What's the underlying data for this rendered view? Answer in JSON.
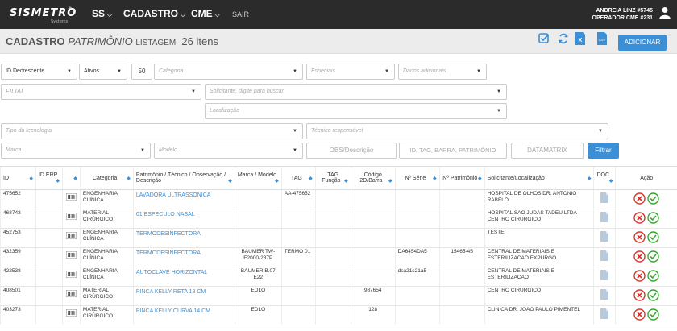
{
  "topbar": {
    "logo": "SISMETRO",
    "logo_sub": "Systems",
    "logo_reg": "®",
    "nav": [
      {
        "label": "SS",
        "caret": "⌵"
      },
      {
        "label": "CADASTRO",
        "caret": "⌵"
      },
      {
        "label": "CME",
        "caret": "⌵"
      }
    ],
    "logout": "SAIR",
    "user_line1": "ANDREIA LINZ #5745",
    "user_line2": "OPERADOR CME #231"
  },
  "header": {
    "title_bold": "CADASTRO",
    "title_italic": "PATRIMÔNIO",
    "title_small": "LISTAGEM",
    "count": "26 itens",
    "add_button": "ADICIONAR",
    "icons": [
      "check-square-icon",
      "refresh-icon",
      "excel-icon",
      "csv-icon"
    ]
  },
  "filters": {
    "order": "ID Decrescente",
    "status": "Ativos",
    "page_size": "50",
    "category": "Categoria",
    "specials": "Especiais",
    "extra": "Dados adicionais",
    "branch": "FILIAL",
    "requester": "Solicitante, digite para buscar",
    "location": "Localização",
    "tech_type": "Tipo da tecnologia",
    "technician": "Técnico responsável",
    "brand": "Marca",
    "model": "Modelo",
    "obs": "OBS/Descrição",
    "id_tag": "ID, TAG, BARRA, PATRIMÔNIO",
    "datamatrix": "DATAMATRIX",
    "filter_button": "Filtrar"
  },
  "table": {
    "columns": [
      "ID",
      "ID ERP",
      "",
      "Categoria",
      "Patrimônio / Técnico / Observação / Descrição",
      "Marca / Modelo",
      "TAG",
      "TAG Função",
      "Código 2D/Barra",
      "Nº Série",
      "Nº Patrimônio",
      "Solicitante/Localização",
      "DOC",
      "Ação"
    ],
    "rows": [
      {
        "id": "475652",
        "erp": "",
        "cat": "ENGENHARIA CLÍNICA",
        "name": "LAVADORA ULTRASSONICA",
        "brand": "",
        "tag": "AA-475652",
        "tagf": "",
        "code": "",
        "serial": "",
        "pat": "",
        "loc": "HOSPITAL DE OLHOS DR. ANTONIO RABELO"
      },
      {
        "id": "468743",
        "erp": "",
        "cat": "MATERIAL CIRÚRGICO",
        "name": "01 ESPECULO NASAL",
        "brand": "",
        "tag": "",
        "tagf": "",
        "code": "",
        "serial": "",
        "pat": "",
        "loc": "HOSPITAL SAO JUDAS TADEU LTDA CENTRO CIRURGICO"
      },
      {
        "id": "452753",
        "erp": "",
        "cat": "ENGENHARIA CLÍNICA",
        "name": "TERMODESINFECTORA",
        "brand": "",
        "tag": "",
        "tagf": "",
        "code": "",
        "serial": "",
        "pat": "",
        "loc": "TESTE"
      },
      {
        "id": "432359",
        "erp": "",
        "cat": "ENGENHARIA CLÍNICA",
        "name": "TERMODESINFECTORA",
        "brand": "BAUMER TW-E2000-287P",
        "tag": "TERMO 01",
        "tagf": "",
        "code": "",
        "serial": "DA6454DA5",
        "pat": "15465-45",
        "loc": "CENTRAL DE MATERIAIS E ESTERILIZACAO EXPURGO"
      },
      {
        "id": "422538",
        "erp": "",
        "cat": "ENGENHARIA CLÍNICA",
        "name": "AUTOCLAVE HORIZONTAL",
        "brand": "BAUMER B.07 E22",
        "tag": "",
        "tagf": "",
        "code": "",
        "serial": "dsa21s21a5",
        "pat": "",
        "loc": "CENTRAL DE MATERIAIS E ESTERILIZACAO"
      },
      {
        "id": "408501",
        "erp": "",
        "cat": "MATERIAL CIRÚRGICO",
        "name": "PINCA KELLY RETA 18 CM",
        "brand": "EDLO",
        "tag": "",
        "tagf": "",
        "code": "987654",
        "serial": "",
        "pat": "",
        "loc": "CENTRO CIRURGICO"
      },
      {
        "id": "403273",
        "erp": "",
        "cat": "MATERIAL CIRÚRGICO",
        "name": "PINCA KELLY CURVA 14 CM",
        "brand": "EDLO",
        "tag": "",
        "tagf": "",
        "code": "128",
        "serial": "",
        "pat": "",
        "loc": "CLINICA DR. JOAO PAULO PIMENTEL"
      }
    ]
  },
  "colors": {
    "accent": "#3b8fd6",
    "topbar": "#2b2b2b",
    "danger": "#d9342b",
    "success": "#3aa335"
  }
}
